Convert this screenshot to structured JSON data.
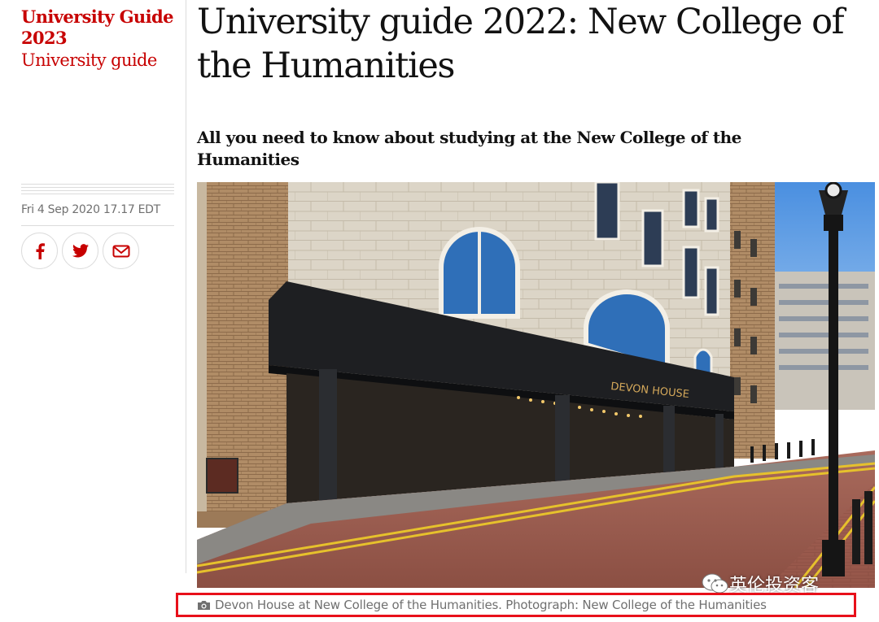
{
  "section": {
    "kicker": "University Guide 2023",
    "subkicker": "University guide"
  },
  "article": {
    "headline": "University guide 2022: New College of the Humanities",
    "standfirst": "All you need to know about studying at the New College of the Humanities",
    "dateline": "Fri 4 Sep 2020 17.17 EDT"
  },
  "share": {
    "icons": [
      "facebook-icon",
      "twitter-icon",
      "email-icon"
    ]
  },
  "photo": {
    "sign_text": "DEVON HOUSE",
    "caption": "Devon House at New College of the Humanities. Photograph: New College of the Humanities"
  },
  "watermark": {
    "text": "英伦投资客"
  },
  "colors": {
    "brand_red": "#c70000",
    "caption_gray": "#707070",
    "highlight_box": "#e8101a"
  }
}
